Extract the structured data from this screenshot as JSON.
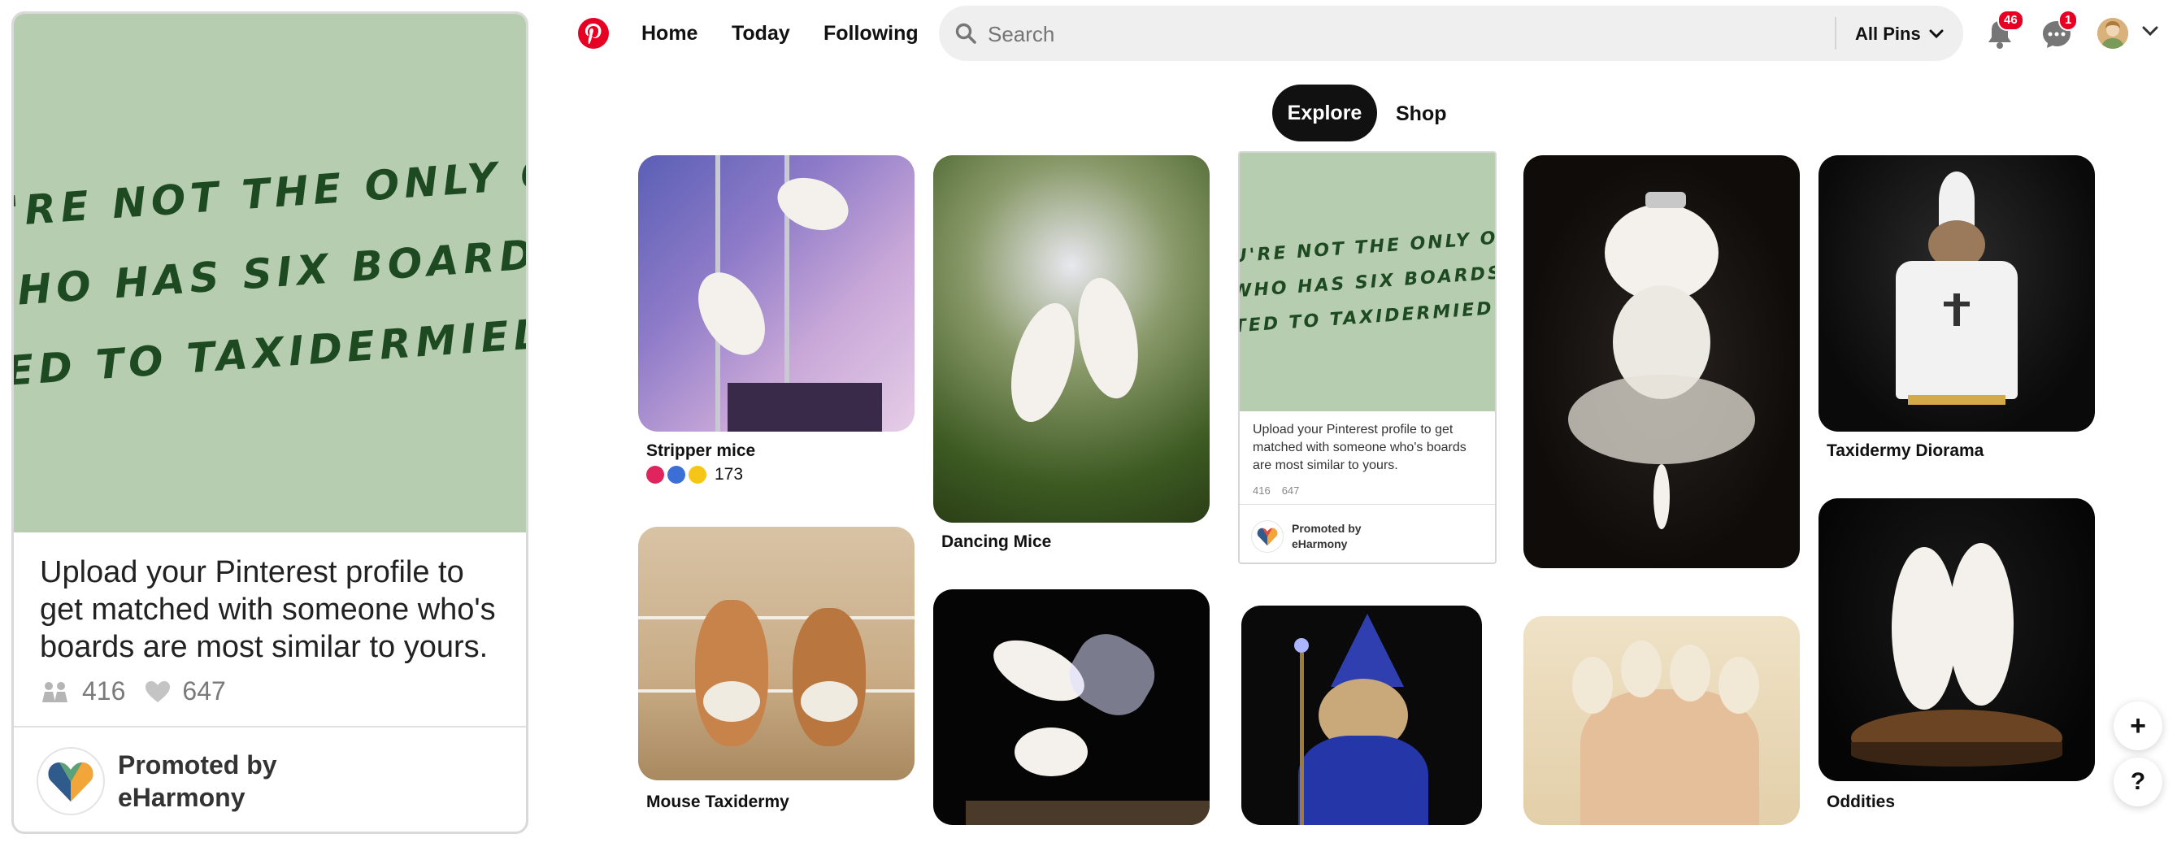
{
  "header": {
    "nav": {
      "home": "Home",
      "today": "Today",
      "following": "Following"
    },
    "search": {
      "placeholder": "Search",
      "scope": "All Pins"
    },
    "notifications_count": "46",
    "messages_count": "1",
    "brand_color": "#e60023"
  },
  "tabs": {
    "explore": "Explore",
    "shop": "Shop"
  },
  "promo": {
    "handwritten_lines": [
      "YOU'RE NOT THE ONLY ONE",
      "WHO HAS SIX BOARDS",
      "DEVOTED TO TAXIDERMIED MICE."
    ],
    "description": "Upload your Pinterest profile to get matched with someone who's boards are most similar to yours.",
    "saves": "416",
    "likes": "647",
    "promoted_label": "Promoted by",
    "advertiser": "eHarmony",
    "art_color": "#b6cdb0"
  },
  "pins": [
    {
      "title": "Stripper mice",
      "reaction_count": "173",
      "reaction_icons": [
        "heart-eyes",
        "laugh",
        "wow"
      ]
    },
    {
      "title": "Dancing Mice"
    },
    {
      "title": "Mouse Taxidermy"
    },
    {
      "title": "Taxidermy Diorama"
    },
    {
      "title": "Oddities"
    }
  ],
  "floating": {
    "add": "+",
    "help": "?"
  }
}
